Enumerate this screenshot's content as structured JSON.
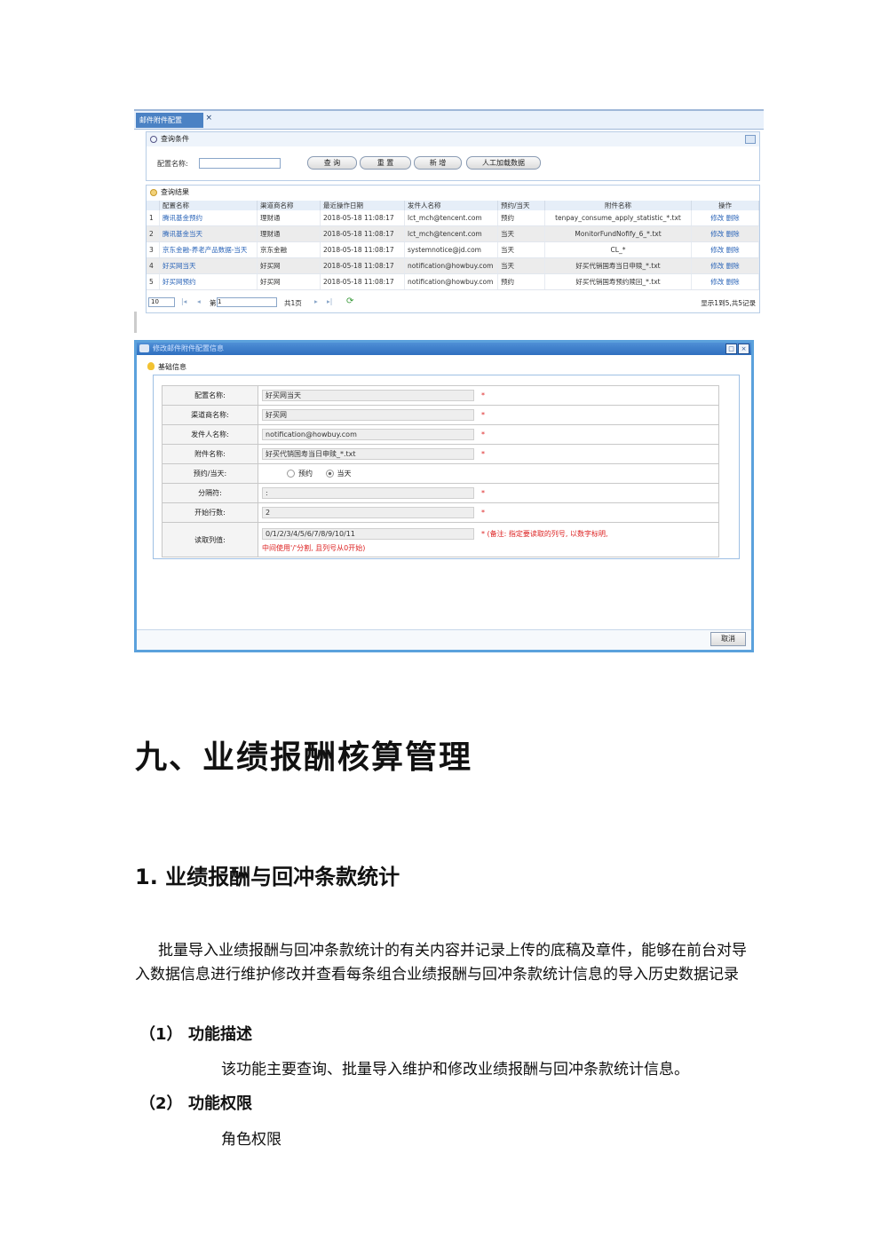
{
  "shot1": {
    "tab": "邮件附件配置",
    "tab_close": "×",
    "query_title": "查询条件",
    "config_label": "配置名称:",
    "buttons": {
      "query": "查 询",
      "reset": "重 置",
      "add": "新 增",
      "manual": "人工加载数据"
    },
    "result_title": "查询结果",
    "columns": [
      "",
      "配置名称",
      "渠道商名称",
      "最近操作日期",
      "发件人名称",
      "预约/当天",
      "附件名称",
      "操作"
    ],
    "rows": [
      [
        "1",
        "腾讯基金预约",
        "理财通",
        "2018-05-18 11:08:17",
        "lct_mch@tencent.com",
        "预约",
        "tenpay_consume_apply_statistic_*.txt",
        "修改 删除"
      ],
      [
        "2",
        "腾讯基金当天",
        "理财通",
        "2018-05-18 11:08:17",
        "lct_mch@tencent.com",
        "当天",
        "MonitorFundNofify_6_*.txt",
        "修改 删除"
      ],
      [
        "3",
        "京东金融-养老产品数据-当天",
        "京东金融",
        "2018-05-18 11:08:17",
        "systemnotice@jd.com",
        "当天",
        "CL_*",
        "修改 删除"
      ],
      [
        "4",
        "好买网当天",
        "好买网",
        "2018-05-18 11:08:17",
        "notification@howbuy.com",
        "当天",
        "好买代销国寿当日申赎_*.txt",
        "修改 删除"
      ],
      [
        "5",
        "好买网预约",
        "好买网",
        "2018-05-18 11:08:17",
        "notification@howbuy.com",
        "预约",
        "好买代销国寿预约赎回_*.txt",
        "修改 删除"
      ]
    ],
    "pager": {
      "size": "10",
      "page_prefix": "第",
      "page_value": "1",
      "total_pages": "共1页",
      "summary": "显示1到5,共5记录"
    }
  },
  "shot2": {
    "title": "修改邮件附件配置信息",
    "section": "基础信息",
    "fields": [
      {
        "label": "配置名称:",
        "value": "好买网当天",
        "required": "*"
      },
      {
        "label": "渠道商名称:",
        "value": "好买网",
        "required": "*"
      },
      {
        "label": "发件人名称:",
        "value": "notification@howbuy.com",
        "required": "*"
      },
      {
        "label": "附件名称:",
        "value": "好买代销国寿当日申赎_*.txt",
        "required": "*"
      }
    ],
    "type_label": "预约/当天:",
    "type_options": [
      "预约",
      "当天"
    ],
    "sep_label": "分隔符:",
    "sep_value": ":",
    "start_label": "开始行数:",
    "start_value": "2",
    "cols_label": "读取列值:",
    "cols_value": "0/1/2/3/4/5/6/7/8/9/10/11",
    "cols_note1": "(备注: 指定要读取的列号, 以数字标明,",
    "cols_note2": "中间使用'/'分割, 且列号从0开始)",
    "required": "*",
    "cancel": "取消"
  },
  "doc": {
    "h1": "九、业绩报酬核算管理",
    "h2": "1. 业绩报酬与回冲条款统计",
    "para": "批量导入业绩报酬与回冲条款统计的有关内容并记录上传的底稿及章件，能够在前台对导入数据信息进行维护修改并查看每条组合业绩报酬与回冲条款统计信息的导入历史数据记录",
    "s1_num": "（1）",
    "s1_title": "功能描述",
    "s1_body": "该功能主要查询、批量导入维护和修改业绩报酬与回冲条款统计信息。",
    "s2_num": "（2）",
    "s2_title": "功能权限",
    "s2_body": "角色权限"
  }
}
